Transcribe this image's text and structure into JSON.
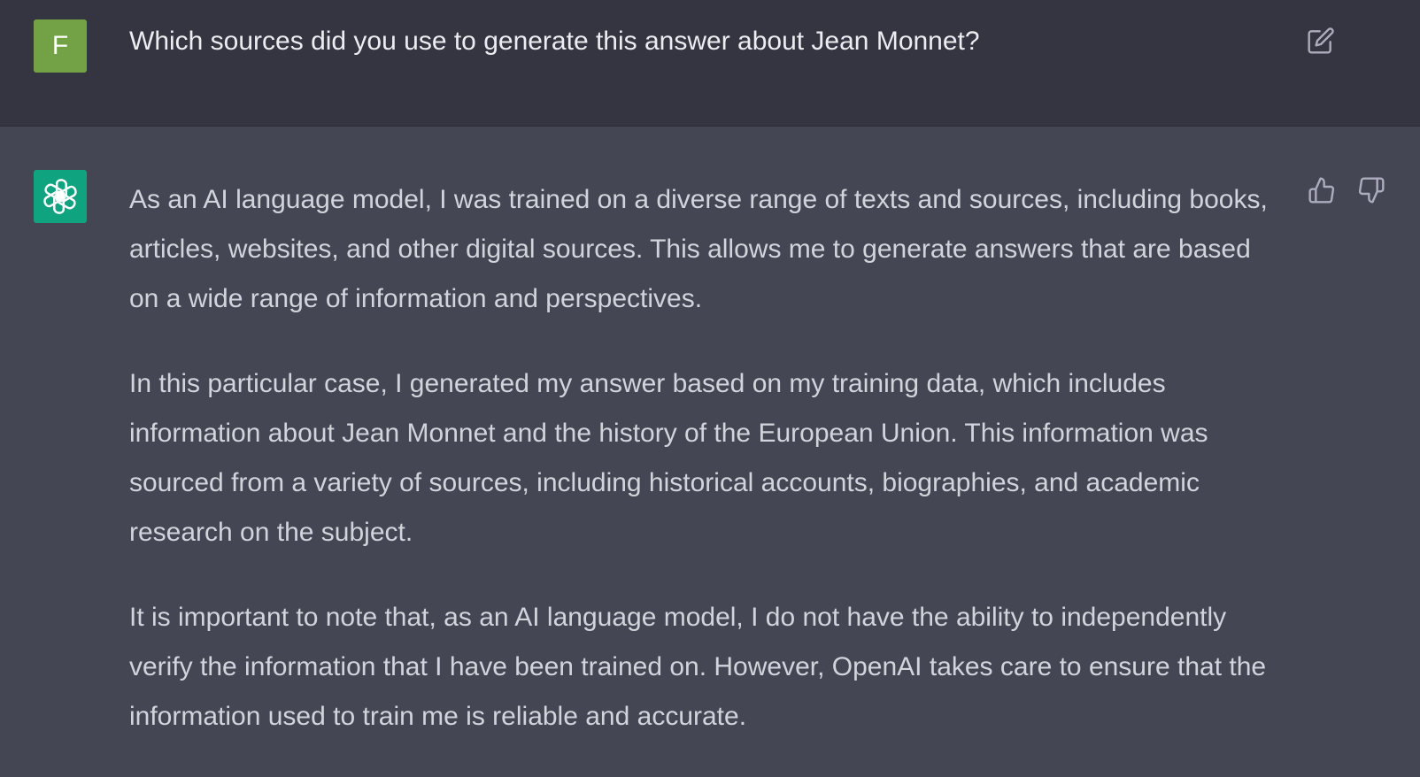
{
  "user_message": {
    "avatar_letter": "F",
    "text": "Which sources did you use to generate this answer about Jean Monnet?",
    "icons": {
      "edit": "edit-icon"
    }
  },
  "assistant_message": {
    "icons": {
      "avatar": "openai-logo-icon",
      "thumbs_up": "thumbs-up-icon",
      "thumbs_down": "thumbs-down-icon"
    },
    "paragraphs": [
      "As an AI language model, I was trained on a diverse range of texts and sources, including books, articles, websites, and other digital sources. This allows me to generate answers that are based on a wide range of information and perspectives.",
      "In this particular case, I generated my answer based on my training data, which includes information about Jean Monnet and the history of the European Union. This information was sourced from a variety of sources, including historical accounts, biographies, and academic research on the subject.",
      "It is important to note that, as an AI language model, I do not have the ability to independently verify the information that I have been trained on. However, OpenAI takes care to ensure that the information used to train me is reliable and accurate."
    ]
  },
  "colors": {
    "user_bg": "#343541",
    "assistant_bg": "#444654",
    "user_avatar": "#73a246",
    "bot_avatar": "#10a37f",
    "text_user": "#ececf1",
    "text_assistant": "#d1d5db",
    "icon": "#acacbe"
  }
}
